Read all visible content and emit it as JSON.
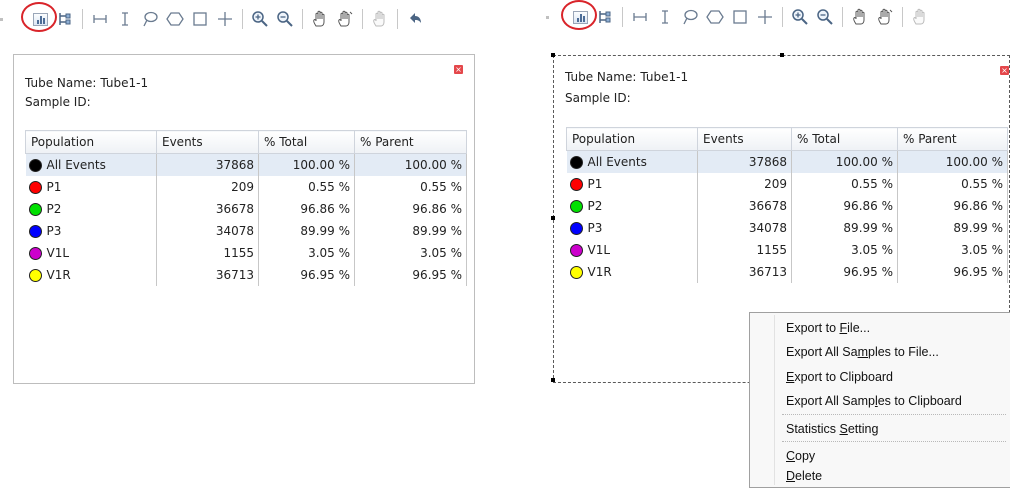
{
  "left": {
    "tube_label": "Tube Name:",
    "tube_value": "Tube1-1",
    "sample_label": "Sample ID:",
    "sample_value": "",
    "close_glyph": "×",
    "columns": [
      "Population",
      "Events",
      "% Total",
      "% Parent"
    ],
    "rows": [
      {
        "name": "All Events",
        "color": "#000000",
        "events": "37868",
        "total": "100.00 %",
        "parent": "100.00 %"
      },
      {
        "name": "P1",
        "color": "#ff0000",
        "events": "209",
        "total": "0.55 %",
        "parent": "0.55 %"
      },
      {
        "name": "P2",
        "color": "#00e000",
        "events": "36678",
        "total": "96.86 %",
        "parent": "96.86 %"
      },
      {
        "name": "P3",
        "color": "#0000ff",
        "events": "34078",
        "total": "89.99 %",
        "parent": "89.99 %"
      },
      {
        "name": "V1L",
        "color": "#cc00cc",
        "events": "1155",
        "total": "3.05 %",
        "parent": "3.05 %"
      },
      {
        "name": "V1R",
        "color": "#ffff00",
        "events": "36713",
        "total": "96.95 %",
        "parent": "96.95 %"
      }
    ]
  },
  "right": {
    "tube_label": "Tube Name:",
    "tube_value": "Tube1-1",
    "sample_label": "Sample ID:",
    "sample_value": "",
    "close_glyph": "×",
    "columns": [
      "Population",
      "Events",
      "% Total",
      "% Parent"
    ],
    "rows": [
      {
        "name": "All Events",
        "color": "#000000",
        "events": "37868",
        "total": "100.00 %",
        "parent": "100.00 %"
      },
      {
        "name": "P1",
        "color": "#ff0000",
        "events": "209",
        "total": "0.55 %",
        "parent": "0.55 %"
      },
      {
        "name": "P2",
        "color": "#00e000",
        "events": "36678",
        "total": "96.86 %",
        "parent": "96.86 %"
      },
      {
        "name": "P3",
        "color": "#0000ff",
        "events": "34078",
        "total": "89.99 %",
        "parent": "89.99 %"
      },
      {
        "name": "V1L",
        "color": "#cc00cc",
        "events": "1155",
        "total": "3.05 %",
        "parent": "3.05 %"
      },
      {
        "name": "V1R",
        "color": "#ffff00",
        "events": "36713",
        "total": "96.95 %",
        "parent": "96.95 %"
      }
    ]
  },
  "context_menu": {
    "export_file": {
      "pre": "Export to ",
      "acc": "F",
      "post": "ile..."
    },
    "export_all_file": {
      "pre": "Export All Sa",
      "acc": "m",
      "post": "ples to File..."
    },
    "export_clip": {
      "pre": "",
      "acc": "E",
      "post": "xport to Clipboard"
    },
    "export_all_clip": {
      "pre": "Export All Samp",
      "acc": "l",
      "post": "es to Clipboard"
    },
    "stats": {
      "pre": "Statistics ",
      "acc": "S",
      "post": "etting"
    },
    "copy": {
      "pre": "",
      "acc": "C",
      "post": "opy"
    },
    "delete": {
      "pre": "",
      "acc": "D",
      "post": "elete"
    }
  },
  "toolbar_icons": [
    "statistics-icon",
    "hierarchy-icon",
    "horizontal-gate-icon",
    "vertical-gate-icon",
    "lasso-gate-icon",
    "polygon-gate-icon",
    "rectangle-gate-icon",
    "quadrant-gate-icon",
    "zoom-in-icon",
    "zoom-out-icon",
    "pan-hand-icon",
    "pan-hand-alt-icon",
    "disabled-hand-icon",
    "undo-icon"
  ],
  "colors": {
    "highlight_circle": "#d9242a",
    "selected_row": "#e3ebf5",
    "close_button": "#e4474b"
  }
}
